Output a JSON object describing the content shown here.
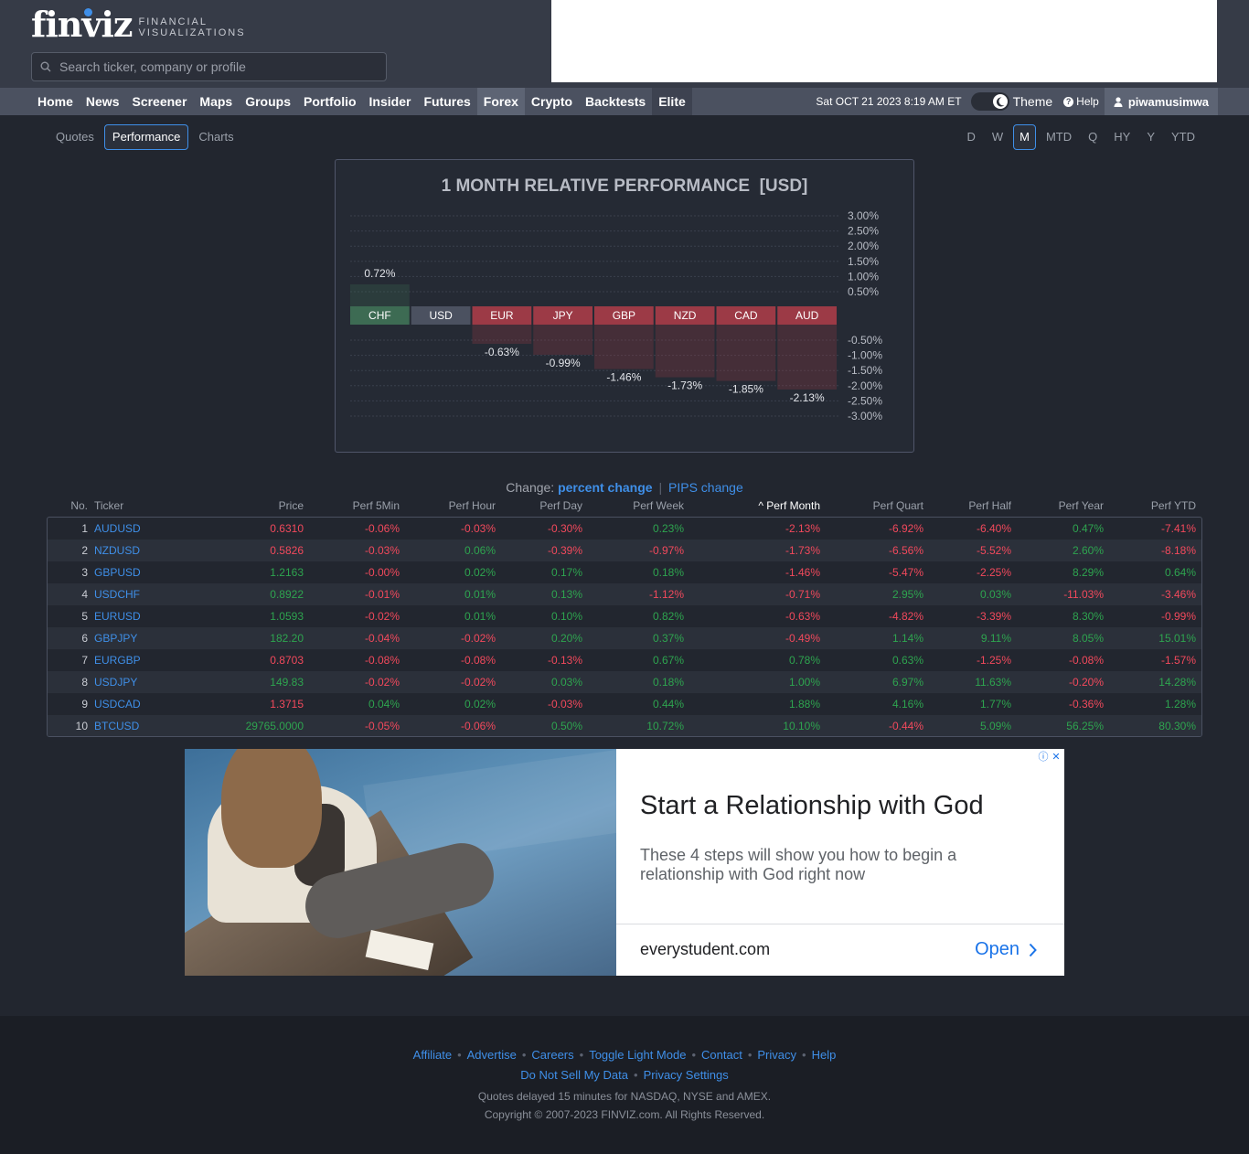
{
  "header": {
    "logo_main": "finviz",
    "logo_sub_1": "FINANCIAL",
    "logo_sub_2": "VISUALIZATIONS",
    "search_placeholder": "Search ticker, company or profile"
  },
  "nav": {
    "items": [
      "Home",
      "News",
      "Screener",
      "Maps",
      "Groups",
      "Portfolio",
      "Insider",
      "Futures",
      "Forex",
      "Crypto",
      "Backtests",
      "Elite"
    ],
    "active": "Forex",
    "datetime": "Sat OCT 21 2023 8:19 AM ET",
    "theme_label": "Theme",
    "help_label": "Help",
    "username": "piwamusimwa"
  },
  "subtabs": [
    "Quotes",
    "Performance",
    "Charts"
  ],
  "subtab_active": "Performance",
  "periods": [
    "D",
    "W",
    "M",
    "MTD",
    "Q",
    "HY",
    "Y",
    "YTD"
  ],
  "period_active": "M",
  "chart_data": {
    "type": "bar",
    "title": "1 MONTH RELATIVE PERFORMANCE  [USD]",
    "categories": [
      "CHF",
      "USD",
      "EUR",
      "JPY",
      "GBP",
      "NZD",
      "CAD",
      "AUD"
    ],
    "values": [
      0.72,
      0,
      -0.63,
      -0.99,
      -1.46,
      -1.73,
      -1.85,
      -2.13
    ],
    "value_labels": [
      "0.72%",
      "",
      "-0.63%",
      "-0.99%",
      "-1.46%",
      "-1.73%",
      "-1.85%",
      "-2.13%"
    ],
    "ylim": [
      -3.0,
      3.0
    ],
    "ticks_pos": [
      "3.00%",
      "2.50%",
      "2.00%",
      "1.50%",
      "1.00%",
      "0.50%"
    ],
    "ticks_neg": [
      "-0.50%",
      "-1.00%",
      "-1.50%",
      "-2.00%",
      "-2.50%",
      "-3.00%"
    ],
    "grid": true,
    "colors": {
      "positive": "#3d6b53",
      "neutral": "#4b5160",
      "negative": "#9c3a46"
    }
  },
  "change": {
    "label": "Change:",
    "percent": "percent change",
    "pips": "PIPS change"
  },
  "table": {
    "headers": [
      "No.",
      "Ticker",
      "Price",
      "Perf 5Min",
      "Perf Hour",
      "Perf Day",
      "Perf Week",
      "Perf Month",
      "Perf Quart",
      "Perf Half",
      "Perf Year",
      "Perf YTD"
    ],
    "sorted_column": "Perf Month",
    "rows": [
      [
        "1",
        "AUDUSD",
        "0.6310",
        "-0.06%",
        "-0.03%",
        "-0.30%",
        "0.23%",
        "-2.13%",
        "-6.92%",
        "-6.40%",
        "0.47%",
        "-7.41%"
      ],
      [
        "2",
        "NZDUSD",
        "0.5826",
        "-0.03%",
        "0.06%",
        "-0.39%",
        "-0.97%",
        "-1.73%",
        "-6.56%",
        "-5.52%",
        "2.60%",
        "-8.18%"
      ],
      [
        "3",
        "GBPUSD",
        "1.2163",
        "-0.00%",
        "0.02%",
        "0.17%",
        "0.18%",
        "-1.46%",
        "-5.47%",
        "-2.25%",
        "8.29%",
        "0.64%"
      ],
      [
        "4",
        "USDCHF",
        "0.8922",
        "-0.01%",
        "0.01%",
        "0.13%",
        "-1.12%",
        "-0.71%",
        "2.95%",
        "0.03%",
        "-11.03%",
        "-3.46%"
      ],
      [
        "5",
        "EURUSD",
        "1.0593",
        "-0.02%",
        "0.01%",
        "0.10%",
        "0.82%",
        "-0.63%",
        "-4.82%",
        "-3.39%",
        "8.30%",
        "-0.99%"
      ],
      [
        "6",
        "GBPJPY",
        "182.20",
        "-0.04%",
        "-0.02%",
        "0.20%",
        "0.37%",
        "-0.49%",
        "1.14%",
        "9.11%",
        "8.05%",
        "15.01%"
      ],
      [
        "7",
        "EURGBP",
        "0.8703",
        "-0.08%",
        "-0.08%",
        "-0.13%",
        "0.67%",
        "0.78%",
        "0.63%",
        "-1.25%",
        "-0.08%",
        "-1.57%"
      ],
      [
        "8",
        "USDJPY",
        "149.83",
        "-0.02%",
        "-0.02%",
        "0.03%",
        "0.18%",
        "1.00%",
        "6.97%",
        "11.63%",
        "-0.20%",
        "14.28%"
      ],
      [
        "9",
        "USDCAD",
        "1.3715",
        "0.04%",
        "0.02%",
        "-0.03%",
        "0.44%",
        "1.88%",
        "4.16%",
        "1.77%",
        "-0.36%",
        "1.28%"
      ],
      [
        "10",
        "BTCUSD",
        "29765.0000",
        "-0.05%",
        "-0.06%",
        "0.50%",
        "10.72%",
        "10.10%",
        "-0.44%",
        "5.09%",
        "56.25%",
        "80.30%"
      ]
    ],
    "price_signs": [
      "neg",
      "neg",
      "pos",
      "pos",
      "pos",
      "pos",
      "neg",
      "pos",
      "neg",
      "pos"
    ]
  },
  "ad": {
    "title": "Start a Relationship with God",
    "description": "These 4 steps will show you how to begin a relationship with God right now",
    "domain": "everystudent.com",
    "cta": "Open"
  },
  "footer": {
    "links_row1": [
      "Affiliate",
      "Advertise",
      "Careers",
      "Toggle Light Mode",
      "Contact",
      "Privacy",
      "Help"
    ],
    "links_row2": [
      "Do Not Sell My Data",
      "Privacy Settings"
    ],
    "note1": "Quotes delayed 15 minutes for NASDAQ, NYSE and AMEX.",
    "note2": "Copyright © 2007-2023 FINVIZ.com. All Rights Reserved."
  }
}
